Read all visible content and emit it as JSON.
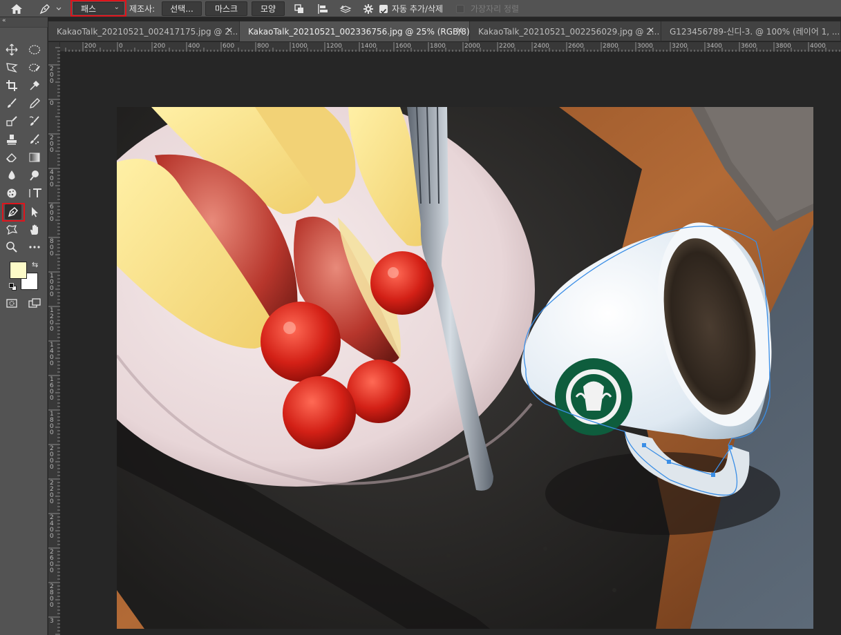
{
  "options_bar": {
    "mode_select": "패스",
    "make_label": "제조사:",
    "selection_btn": "선택...",
    "mask_btn": "마스크",
    "shape_btn": "모양",
    "auto_add_delete_label": "자동 추가/삭제",
    "auto_add_delete_checked": true,
    "align_edges_label": "가장자리 정렬",
    "align_edges_checked": false
  },
  "tabs": [
    {
      "label": "KakaoTalk_20210521_002417175.jpg @ 2...",
      "active": false
    },
    {
      "label": "KakaoTalk_20210521_002336756.jpg @ 25% (RGB/8) *",
      "active": true
    },
    {
      "label": "KakaoTalk_20210521_002256029.jpg @ 2...",
      "active": false
    },
    {
      "label": "G123456789-신디-3. @ 100% (레이어 1, ...",
      "active": false
    }
  ],
  "ruler_h_labels": [
    "200",
    "0",
    "200",
    "400",
    "600",
    "800",
    "1000",
    "1200",
    "1400",
    "1600",
    "1800",
    "2000",
    "2200",
    "2400",
    "2600",
    "2800",
    "3000",
    "3200",
    "3400",
    "3600",
    "3800",
    "4000"
  ],
  "ruler_v_labels": [
    "200",
    "0",
    "200",
    "400",
    "600",
    "800",
    "1000",
    "1200",
    "1400",
    "1600",
    "1800",
    "2000",
    "2200",
    "2400",
    "2600",
    "2800",
    "3"
  ],
  "colors": {
    "foreground": "#fdfbc8",
    "background": "#ffffff",
    "highlight": "#e0141c",
    "path": "#3a8ee6"
  },
  "tools": [
    "move-icon",
    "marquee-icon",
    "lasso-icon",
    "quick-select-icon",
    "crop-icon",
    "eyedropper-icon",
    "brush-icon",
    "pencil-icon",
    "clone-stamp-icon",
    "history-brush-icon",
    "stamp-icon",
    "smudge-icon",
    "eraser-icon",
    "gradient-icon",
    "blur-icon",
    "dodge-icon",
    "sponge-icon",
    "type-icon",
    "pen-icon",
    "path-select-icon",
    "shape-icon",
    "hand-icon",
    "zoom-icon",
    "more-icon"
  ]
}
